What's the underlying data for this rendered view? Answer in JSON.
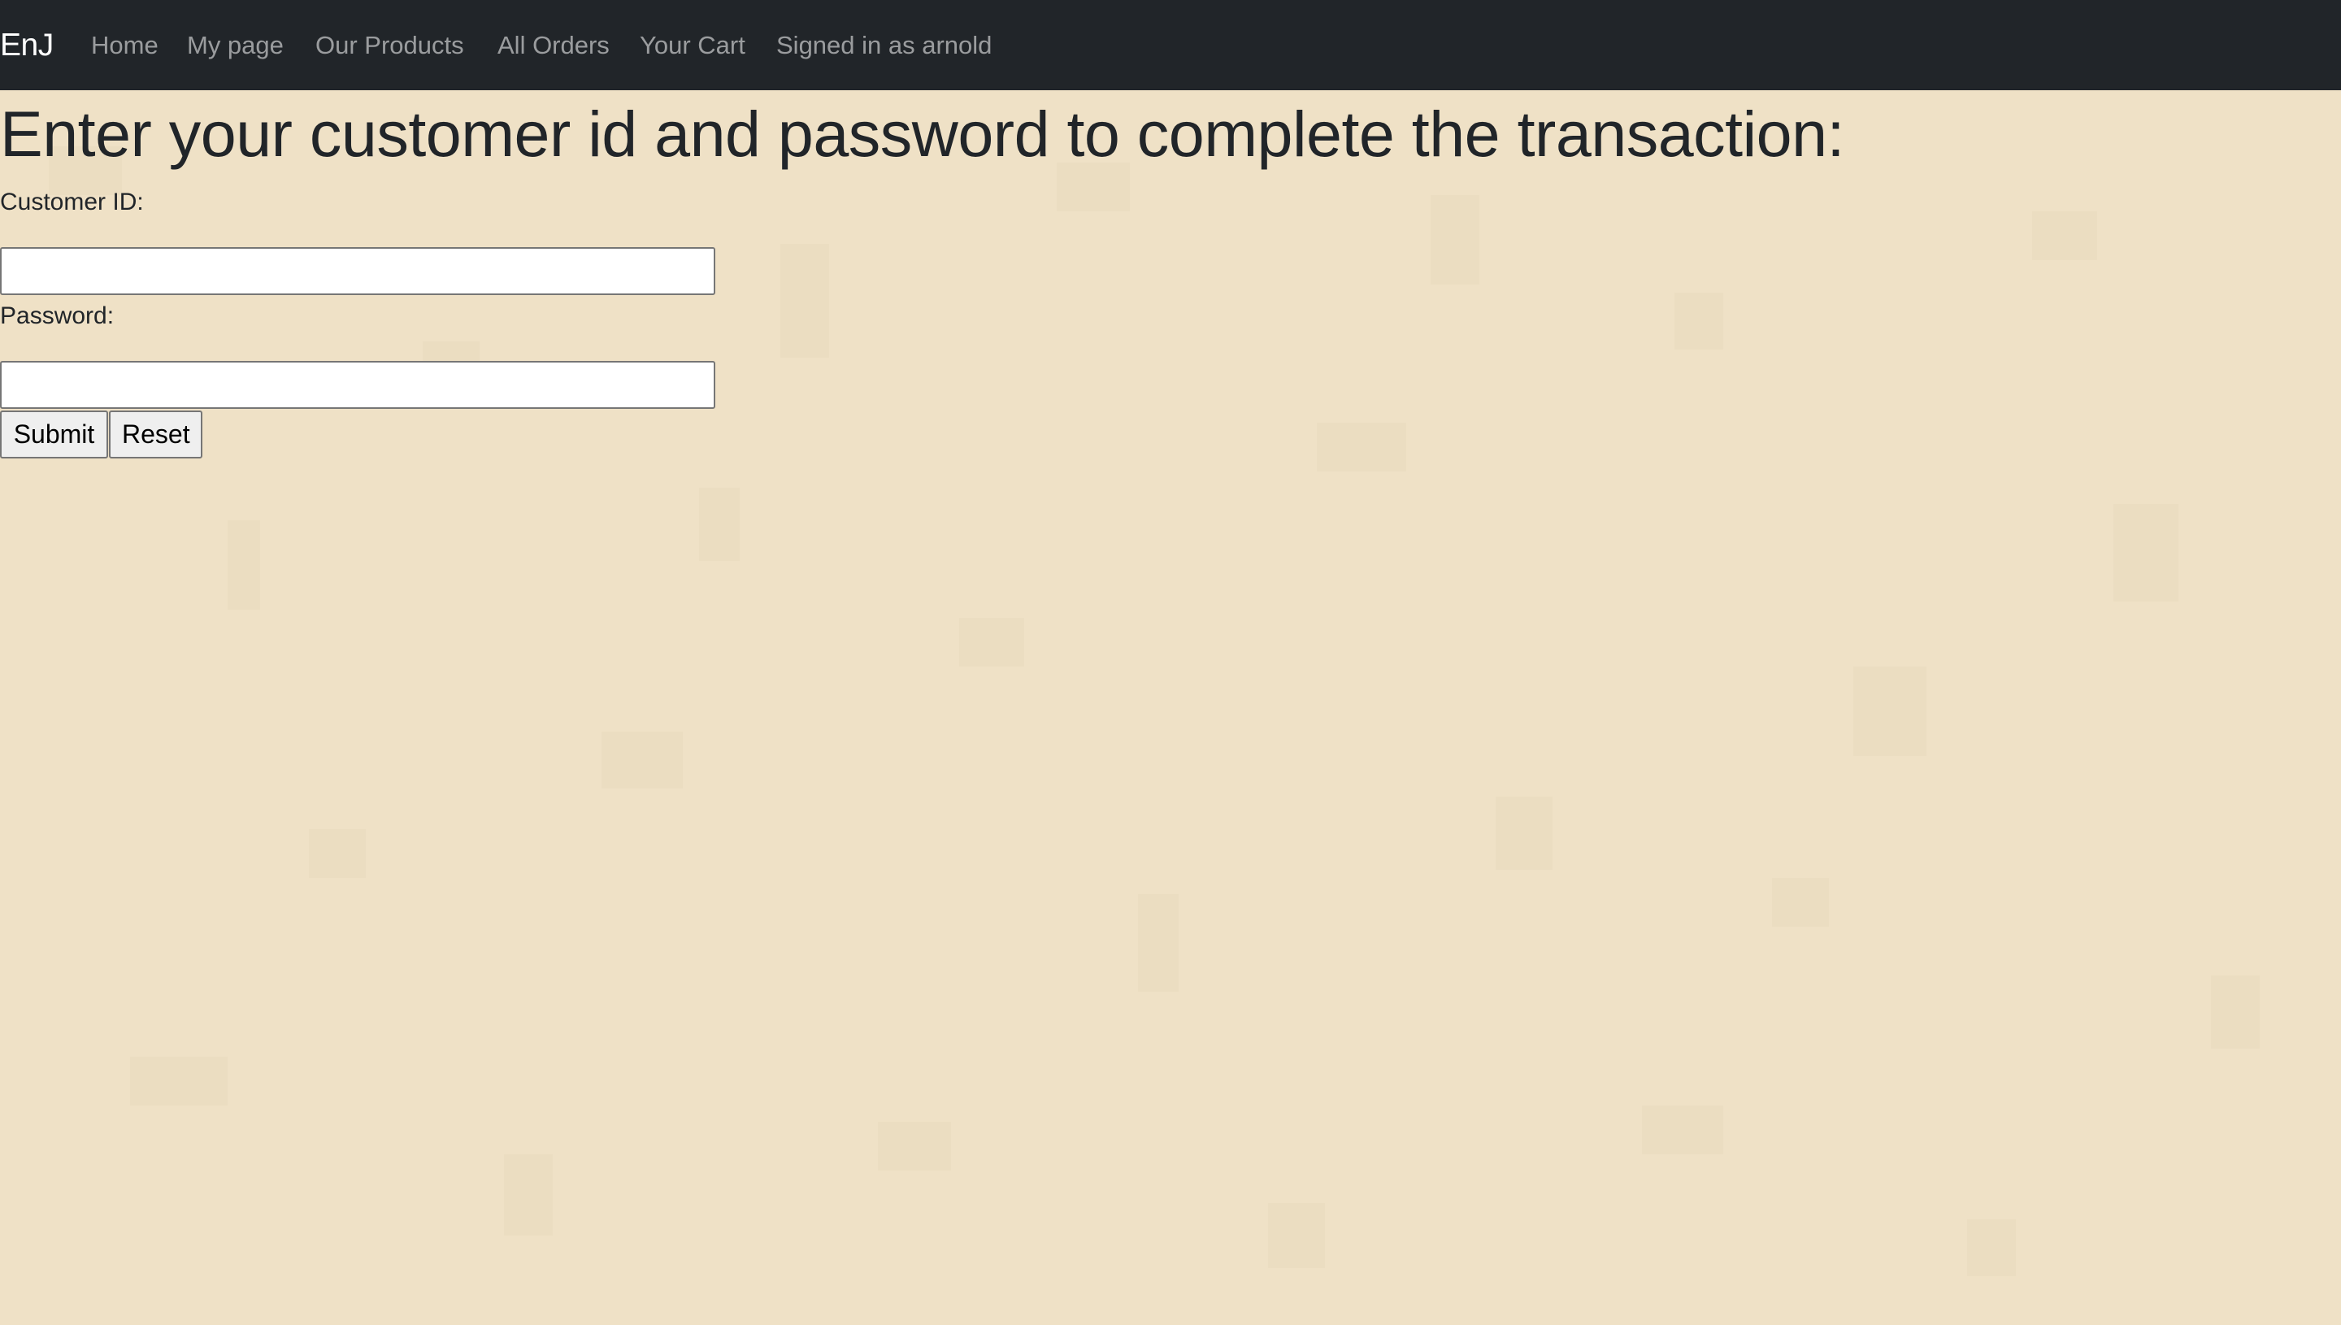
{
  "navbar": {
    "brand": "EnJ",
    "links": [
      {
        "label": "Home"
      },
      {
        "label": "My page"
      },
      {
        "label": "Our Products"
      },
      {
        "label": "All Orders"
      },
      {
        "label": "Your Cart"
      },
      {
        "label": "Signed in as arnold"
      }
    ]
  },
  "main": {
    "title": "Enter your customer id and password to complete the transaction:",
    "customer_id": {
      "label": "Customer ID:",
      "value": ""
    },
    "password": {
      "label": "Password:",
      "value": ""
    },
    "submit_label": "Submit",
    "reset_label": "Reset"
  },
  "colors": {
    "navbar_bg": "#212529",
    "page_bg": "#efe1c6",
    "nav_link": "rgba(255,255,255,0.55)",
    "brand": "#ffffff"
  }
}
